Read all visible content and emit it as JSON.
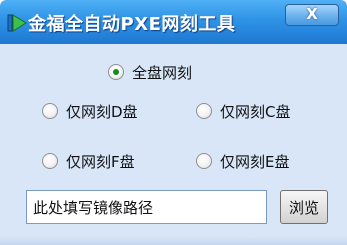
{
  "window": {
    "title": "金福全自动PXE网刻工具",
    "close_label": "X"
  },
  "options": {
    "all_disk": "全盘网刻",
    "only_d": "仅网刻D盘",
    "only_c": "仅网刻C盘",
    "only_f": "仅网刻F盘",
    "only_e": "仅网刻E盘",
    "selected": "全盘网刻"
  },
  "image_path": {
    "value": "此处填写镜像路径"
  },
  "browse": {
    "label": "浏览"
  },
  "colors": {
    "titlebar": "#2e93e6",
    "body": "#d8e6f8",
    "selected_dot": "#1a8a1a"
  },
  "icons": {
    "app": "play-arrow-icon",
    "close": "close-icon"
  }
}
